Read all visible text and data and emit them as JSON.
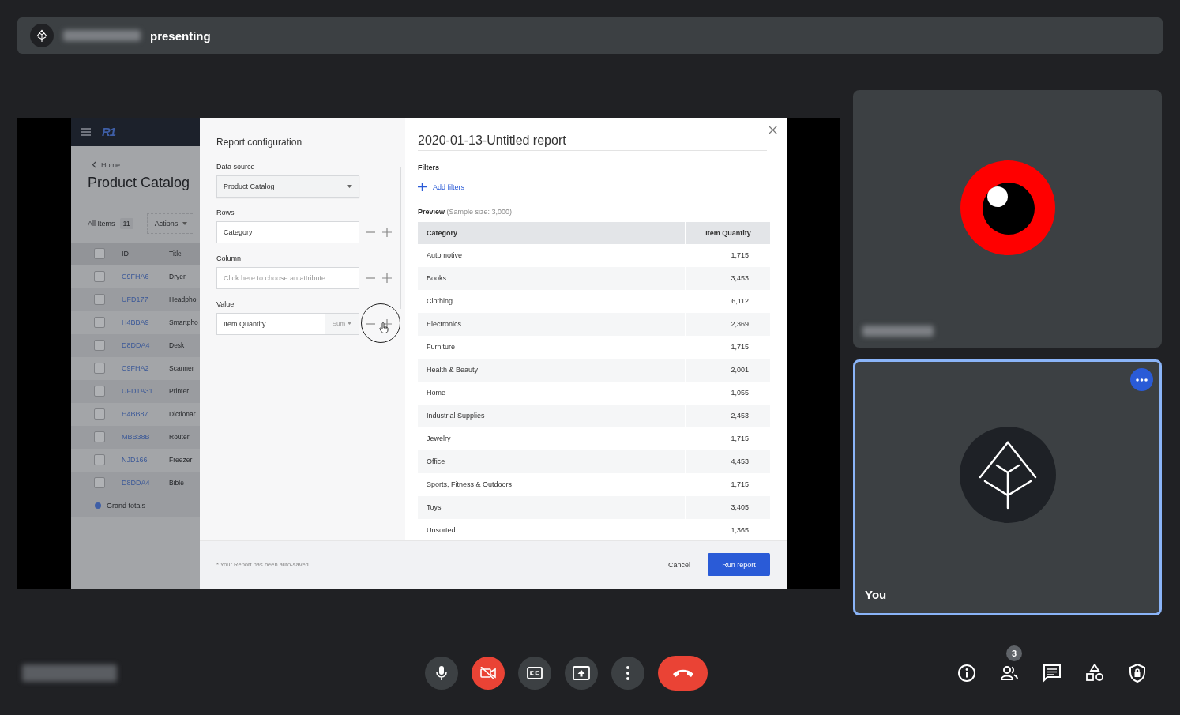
{
  "presenter_bar": {
    "name_blurred": true,
    "status": "presenting"
  },
  "shared_screen": {
    "app": {
      "logo": "R1",
      "breadcrumb": "Home",
      "title": "Product Catalog",
      "items_label": "All Items",
      "items_count": "11",
      "actions": "Actions",
      "columns": [
        "ID",
        "Title"
      ],
      "header_checked": false,
      "rows": [
        {
          "id": "C9FHA6",
          "title": "Dryer",
          "checked": false
        },
        {
          "id": "UFD177",
          "title": "Headpho",
          "checked": false
        },
        {
          "id": "H4BBA9",
          "title": "Smartpho",
          "checked": false
        },
        {
          "id": "D8DDA4",
          "title": "Desk",
          "checked": false
        },
        {
          "id": "C9FHA2",
          "title": "Scanner",
          "checked": false
        },
        {
          "id": "UFD1A31",
          "title": "Printer",
          "checked": false
        },
        {
          "id": "H4BB87",
          "title": "Dictionar",
          "checked": false
        },
        {
          "id": "MBB38B",
          "title": "Router",
          "checked": false
        },
        {
          "id": "NJD166",
          "title": "Freezer",
          "checked": false
        },
        {
          "id": "D8DDA4",
          "title": "Bible",
          "checked": false
        }
      ],
      "totals": "Grand totals"
    },
    "dialog": {
      "config_title": "Report configuration",
      "fields": [
        {
          "kind": "select",
          "label": "Data source",
          "value": "Product Catalog"
        },
        {
          "kind": "attribute",
          "label": "Rows",
          "value": "Category"
        },
        {
          "kind": "attribute",
          "label": "Column",
          "placeholder": "Click here to choose an attribute"
        },
        {
          "kind": "aggregate",
          "label": "Value",
          "value": "Item Quantity",
          "aggregate": "Sum"
        }
      ],
      "report_title": "2020-01-13-Untitled report",
      "filters_label": "Filters",
      "add_filters": "Add filters",
      "preview_label": "Preview",
      "sample_size": "(Sample size: 3,000)",
      "table": {
        "columns": [
          "Category",
          "Item Quantity"
        ],
        "rows": [
          [
            "Automotive",
            "1,715"
          ],
          [
            "Books",
            "3,453"
          ],
          [
            "Clothing",
            "6,112"
          ],
          [
            "Electronics",
            "2,369"
          ],
          [
            "Furniture",
            "1,715"
          ],
          [
            "Health & Beauty",
            "2,001"
          ],
          [
            "Home",
            "1,055"
          ],
          [
            "Industrial Supplies",
            "2,453"
          ],
          [
            "Jewelry",
            "1,715"
          ],
          [
            "Office",
            "4,453"
          ],
          [
            "Sports, Fitness & Outdoors",
            "1,715"
          ],
          [
            "Toys",
            "3,405"
          ],
          [
            "Unsorted",
            "1,365"
          ]
        ]
      },
      "footer_note": "* Your Report has been auto-saved.",
      "buttons": [
        {
          "kind": "text",
          "label": "Cancel"
        },
        {
          "kind": "primary",
          "label": "Run report"
        }
      ]
    }
  },
  "participants": [
    {
      "kind": "remote",
      "name_blurred": true,
      "highlighted": false
    },
    {
      "kind": "self",
      "name": "You",
      "highlighted": true,
      "menu": true
    }
  ],
  "meeting_code_blurred": true,
  "controls": [
    {
      "kind": "mic",
      "on": true
    },
    {
      "kind": "camera",
      "on": false
    },
    {
      "kind": "captions"
    },
    {
      "kind": "present"
    },
    {
      "kind": "more"
    },
    {
      "kind": "hangup"
    }
  ],
  "side_controls": [
    {
      "kind": "info"
    },
    {
      "kind": "people",
      "badge": "3"
    },
    {
      "kind": "chat"
    },
    {
      "kind": "activities"
    },
    {
      "kind": "safety"
    }
  ]
}
